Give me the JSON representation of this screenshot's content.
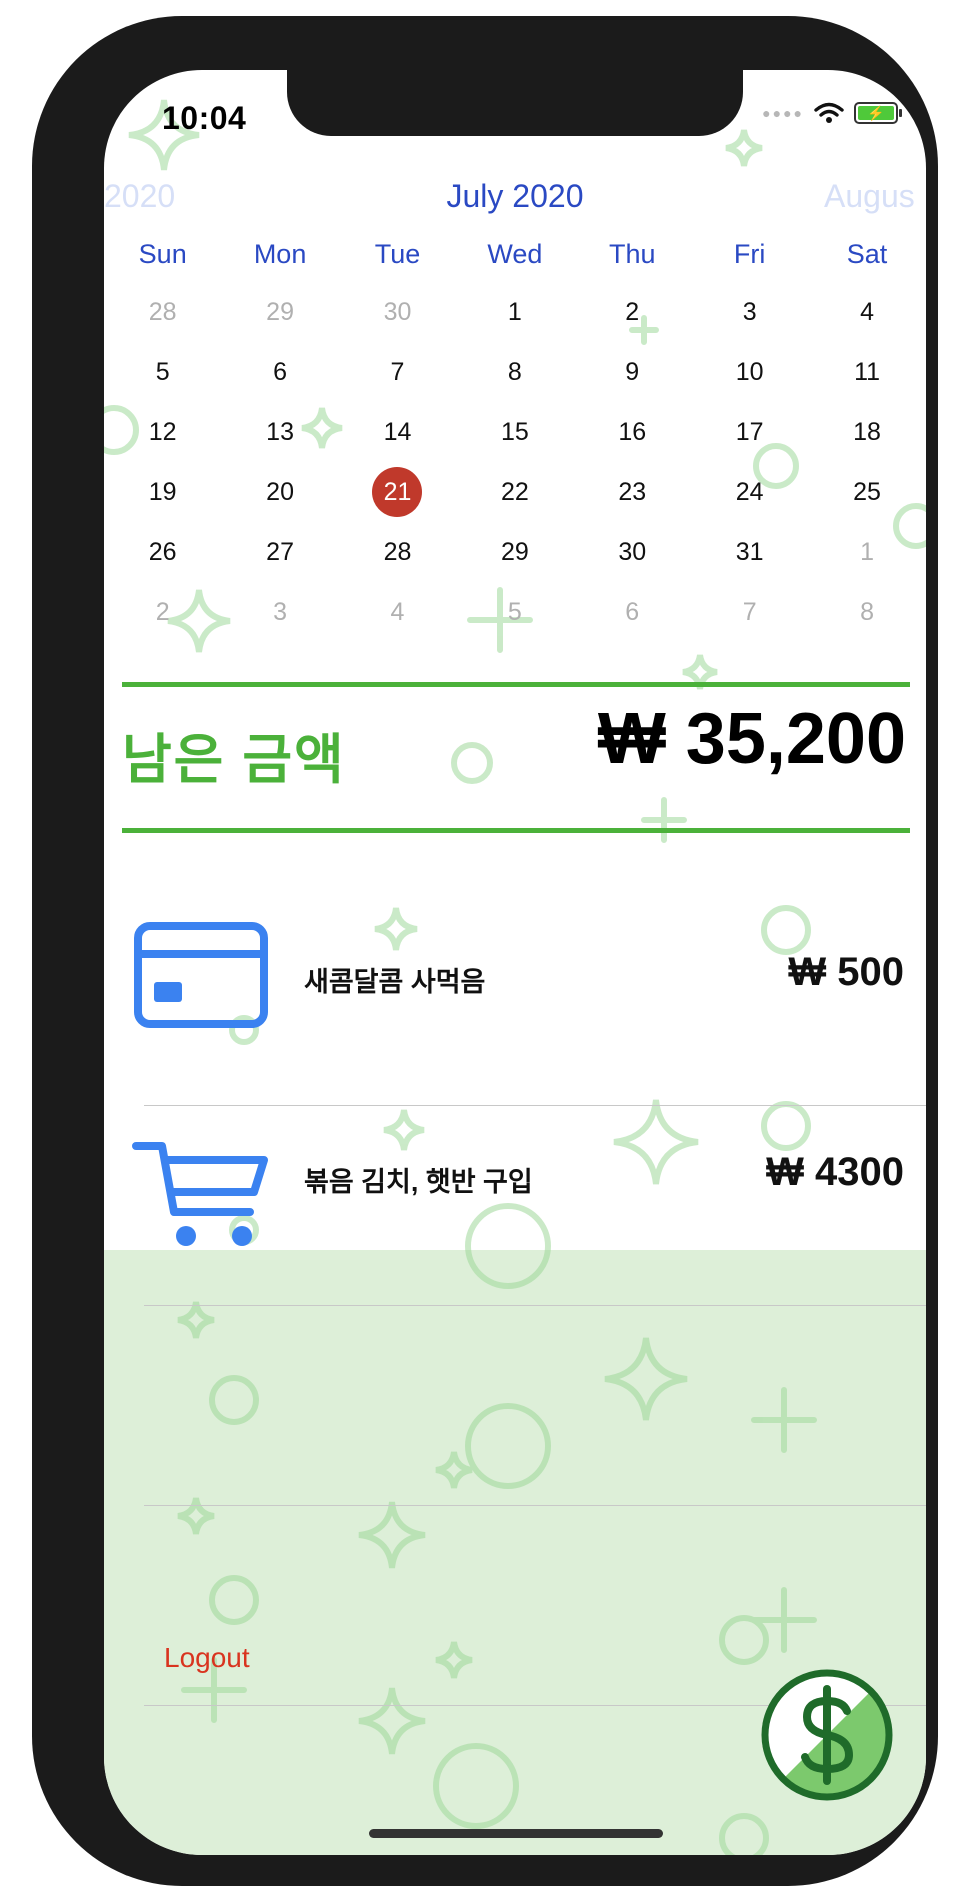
{
  "status_bar": {
    "time": "10:04"
  },
  "calendar": {
    "prev_month": "2020",
    "current_month": "July 2020",
    "next_month": "Augus",
    "weekdays": [
      "Sun",
      "Mon",
      "Tue",
      "Wed",
      "Thu",
      "Fri",
      "Sat"
    ],
    "weeks": [
      [
        "28",
        "29",
        "30",
        "1",
        "2",
        "3",
        "4"
      ],
      [
        "5",
        "6",
        "7",
        "8",
        "9",
        "10",
        "11"
      ],
      [
        "12",
        "13",
        "14",
        "15",
        "16",
        "17",
        "18"
      ],
      [
        "19",
        "20",
        "21",
        "22",
        "23",
        "24",
        "25"
      ],
      [
        "26",
        "27",
        "28",
        "29",
        "30",
        "31",
        "1"
      ],
      [
        "2",
        "3",
        "4",
        "5",
        "6",
        "7",
        "8"
      ]
    ],
    "selected_day": "21"
  },
  "balance": {
    "label": "남은 금액",
    "amount": "₩ 35,200"
  },
  "transactions": [
    {
      "icon": "credit-card-icon",
      "title": "새콤달콤 사먹음",
      "amount": "₩ 500"
    },
    {
      "icon": "shopping-cart-icon",
      "title": "볶음 김치, 햇반 구입",
      "amount": "₩ 4300"
    }
  ],
  "logout_label": "Logout",
  "colors": {
    "accent_green": "#4bb13a",
    "calendar_blue": "#2a49c3",
    "today_red": "#c0392b",
    "logout_red": "#d9341f",
    "icon_blue": "#3b82f0",
    "empty_area_green": "#ddefd8"
  }
}
